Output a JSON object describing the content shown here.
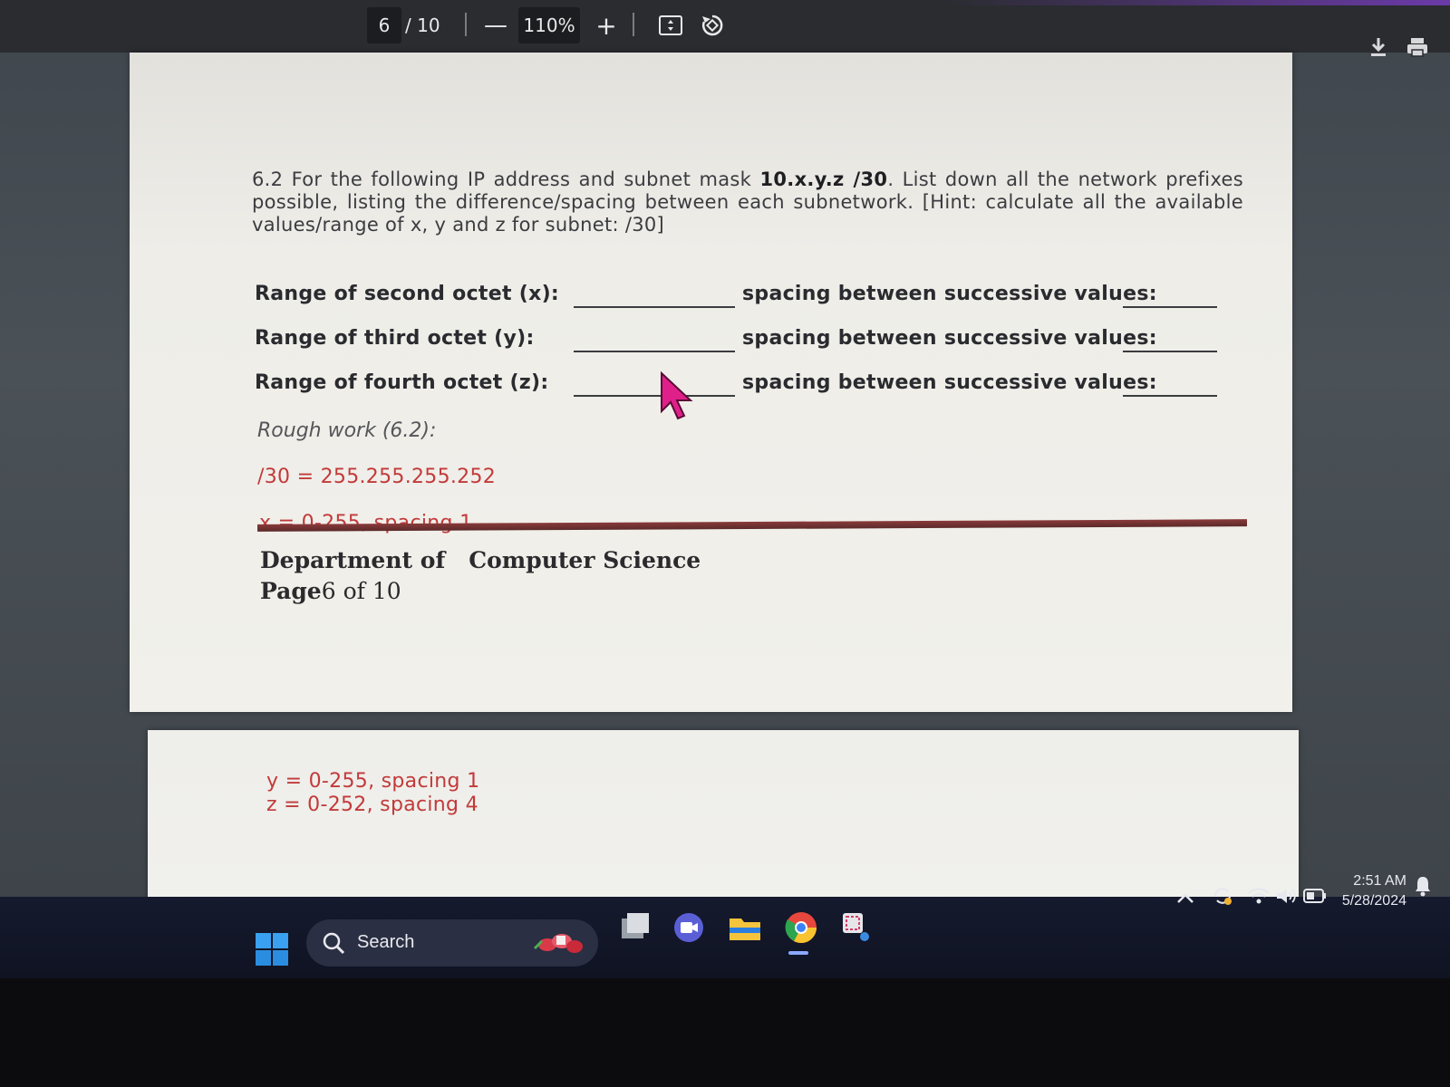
{
  "toolbar": {
    "current_page": "6",
    "total_pages": "/ 10",
    "zoom_minus": "—",
    "zoom_level": "110%",
    "zoom_plus": "+",
    "icons": [
      "fit-page-icon",
      "rotate-icon",
      "download-icon",
      "print-icon"
    ]
  },
  "document": {
    "question": {
      "prefix": "6.2 For the following IP address and subnet mask ",
      "address": "10.x.y.z /30",
      "suffix": ". List down all the network prefixes possible, listing the difference/spacing between each subnetwork. [Hint: calculate all the available values/range of x, y and z for subnet: /30]"
    },
    "rows": [
      {
        "label": "Range of second octet (x):",
        "spacing_label": "spacing between successive values:"
      },
      {
        "label": "Range of third octet (y):",
        "spacing_label": "spacing between successive values:"
      },
      {
        "label": "Range of fourth octet (z):",
        "spacing_label": "spacing between successive values:"
      }
    ],
    "rough_work_label": "Rough work (6.2):",
    "rough_lines": [
      "/30 = 255.255.255.252",
      "x = 0-255, spacing 1"
    ],
    "footer": {
      "dept_1": "Department of",
      "dept_2": "Computer Science",
      "page_bold": "Page",
      "page_rest": "6 of 10"
    },
    "page2_lines": [
      "y = 0-255, spacing 1",
      "z = 0-252, spacing 4"
    ]
  },
  "taskbar": {
    "search_label": "Search",
    "apps": [
      "task-view-icon",
      "video-chat-icon",
      "file-explorer-icon",
      "chrome-icon",
      "snipping-tool-icon"
    ],
    "time": "2:51 AM",
    "date": "5/28/2024"
  },
  "colors": {
    "annotation_red": "#c23a3a",
    "footer_rule": "#6e2f2f",
    "taskbar": "#12172a"
  }
}
